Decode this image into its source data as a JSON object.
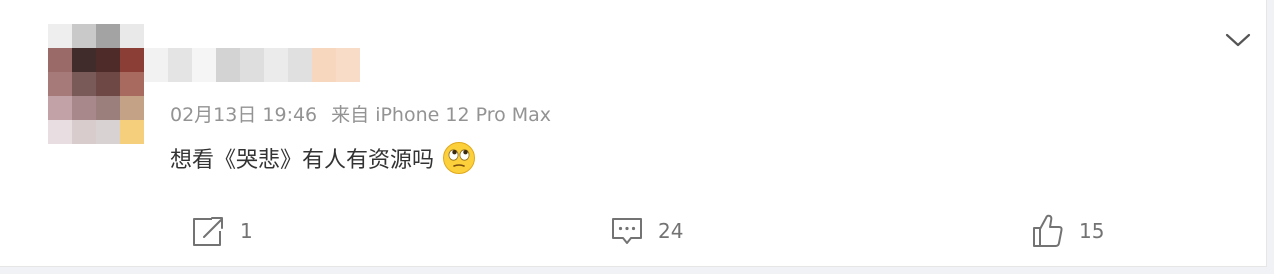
{
  "post": {
    "timestamp": "02月13日 19:46",
    "source": "来自 iPhone 12 Pro Max",
    "text": "想看《哭悲》有人有资源吗",
    "emoji": "rolling-eyes-emoji"
  },
  "actions": {
    "forward_count": "1",
    "comment_count": "24",
    "like_count": "15"
  },
  "icons": {
    "dropdown": "chevron-down-icon",
    "forward": "share-icon",
    "comment": "comment-icon",
    "like": "thumbs-up-icon"
  },
  "colors": {
    "text": "#333333",
    "meta": "#939393",
    "icon": "#737373",
    "background": "#f1f2f5"
  }
}
